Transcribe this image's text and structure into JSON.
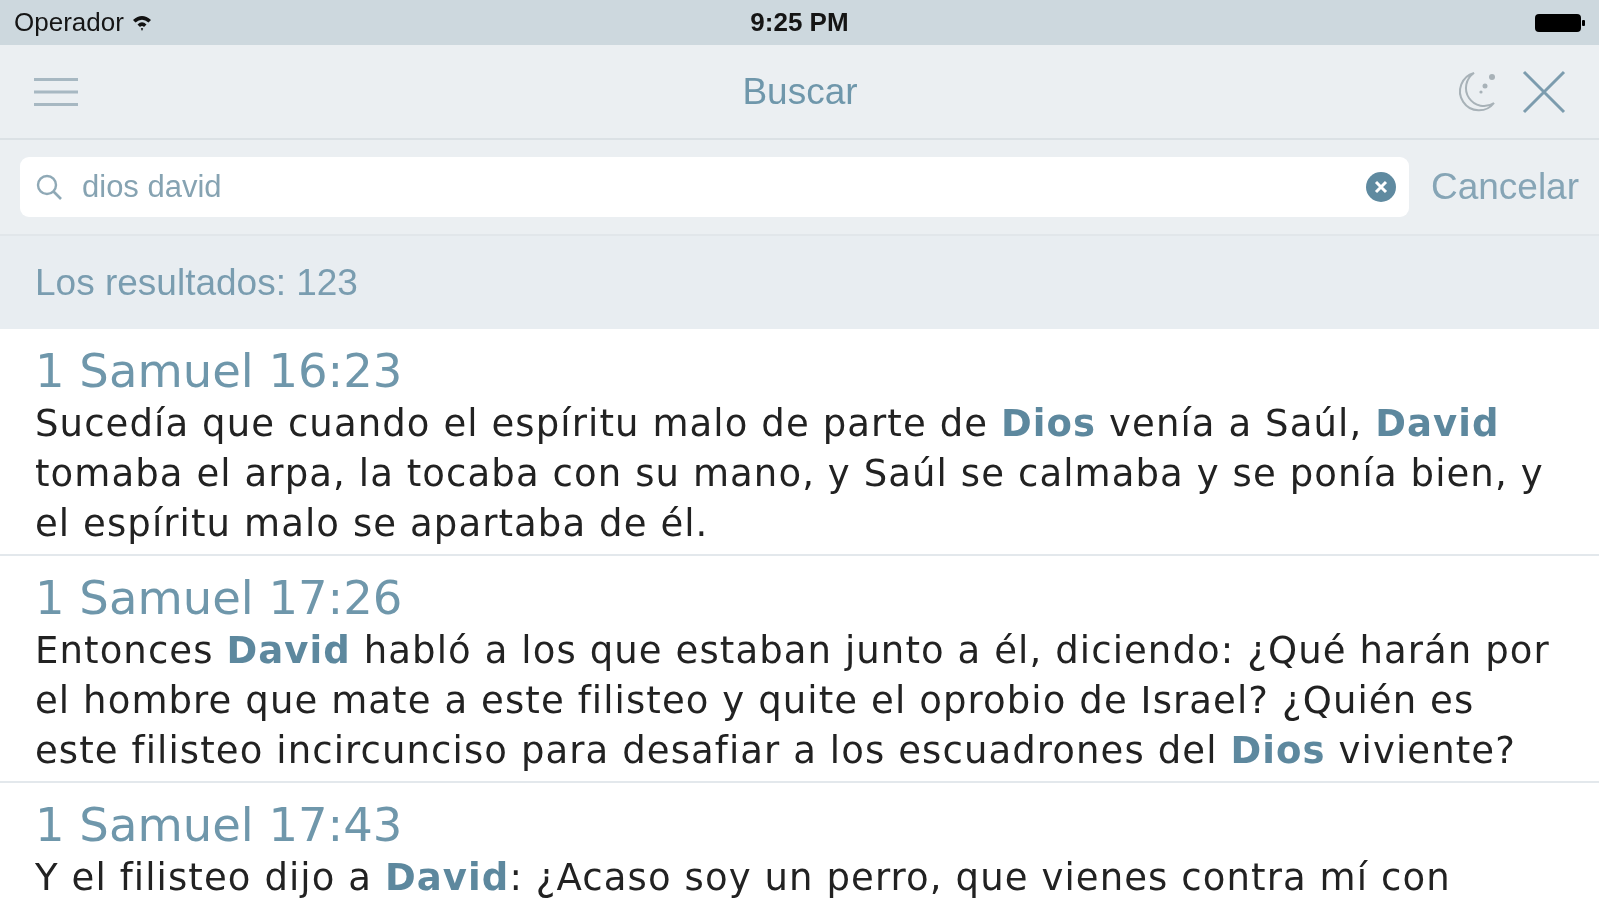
{
  "status_bar": {
    "carrier": "Operador",
    "time": "9:25 PM"
  },
  "nav_bar": {
    "title": "Buscar"
  },
  "search": {
    "value": "dios david",
    "cancel": "Cancelar"
  },
  "results": {
    "summary": "Los resultados: 123",
    "items": [
      {
        "reference": "1 Samuel 16:23",
        "text": "Sucedía que cuando el espíritu malo de parte de **Dios** venía a Saúl, **David** tomaba el arpa, la tocaba con su mano, y Saúl se calmaba y se ponía bien, y el espíritu malo se apartaba de él."
      },
      {
        "reference": "1 Samuel 17:26",
        "text": "Entonces **David** habló a los que estaban junto a él, diciendo: ¿Qué harán por el hombre que mate a este filisteo y quite el oprobio de Israel? ¿Quién es este filisteo incircunciso para desafiar a los escuadrones del **Dios** viviente?"
      },
      {
        "reference": "1 Samuel 17:43",
        "text": "Y el filisteo dijo a **David**: ¿Acaso soy un perro, que vienes contra mí con"
      }
    ]
  }
}
